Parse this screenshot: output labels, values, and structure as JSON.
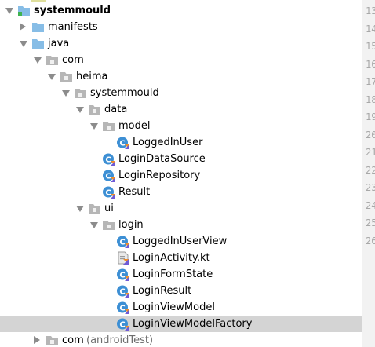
{
  "tree": {
    "items": [
      {
        "name": "folder-systemmould",
        "icon": "module-folder-icon",
        "label": "systemmould",
        "bold": true,
        "depth": 0,
        "arrow": "down"
      },
      {
        "name": "folder-manifests",
        "icon": "blue-folder-icon",
        "label": "manifests",
        "depth": 1,
        "arrow": "right"
      },
      {
        "name": "folder-java",
        "icon": "blue-folder-icon",
        "label": "java",
        "depth": 1,
        "arrow": "down"
      },
      {
        "name": "package-com",
        "icon": "package-icon",
        "label": "com",
        "depth": 2,
        "arrow": "down"
      },
      {
        "name": "package-heima",
        "icon": "package-icon",
        "label": "heima",
        "depth": 3,
        "arrow": "down"
      },
      {
        "name": "package-systemmould",
        "icon": "package-icon",
        "label": "systemmould",
        "depth": 4,
        "arrow": "down"
      },
      {
        "name": "package-data",
        "icon": "package-icon",
        "label": "data",
        "depth": 5,
        "arrow": "down"
      },
      {
        "name": "package-model",
        "icon": "package-icon",
        "label": "model",
        "depth": 6,
        "arrow": "down"
      },
      {
        "name": "class-loggedinuser",
        "icon": "kotlin-class-icon",
        "label": "LoggedInUser",
        "depth": 7
      },
      {
        "name": "class-logindatasource",
        "icon": "kotlin-class-icon",
        "label": "LoginDataSource",
        "depth": 6
      },
      {
        "name": "class-loginrepository",
        "icon": "kotlin-class-icon",
        "label": "LoginRepository",
        "depth": 6
      },
      {
        "name": "class-result",
        "icon": "kotlin-class-icon",
        "label": "Result",
        "depth": 6
      },
      {
        "name": "package-ui",
        "icon": "package-icon",
        "label": "ui",
        "depth": 5,
        "arrow": "down"
      },
      {
        "name": "package-login",
        "icon": "package-icon",
        "label": "login",
        "depth": 6,
        "arrow": "down"
      },
      {
        "name": "class-loggedinuserview",
        "icon": "kotlin-class-icon",
        "label": "LoggedInUserView",
        "depth": 7
      },
      {
        "name": "file-loginactivity",
        "icon": "kotlin-file-icon",
        "label": "LoginActivity.kt",
        "depth": 7
      },
      {
        "name": "class-loginformstate",
        "icon": "kotlin-class-icon",
        "label": "LoginFormState",
        "depth": 7
      },
      {
        "name": "class-loginresult",
        "icon": "kotlin-class-icon",
        "label": "LoginResult",
        "depth": 7
      },
      {
        "name": "class-loginviewmodel",
        "icon": "kotlin-class-icon",
        "label": "LoginViewModel",
        "depth": 7
      },
      {
        "name": "class-loginviewmodelfactory",
        "icon": "kotlin-class-icon",
        "label": "LoginViewModelFactory",
        "depth": 7,
        "selected": true
      },
      {
        "name": "package-com-androidtest",
        "icon": "package-icon",
        "label": "com",
        "suffix": "(androidTest)",
        "depth": 2,
        "arrow": "right"
      }
    ]
  },
  "gutter": {
    "line_numbers": [
      "13",
      "14",
      "15",
      "16",
      "17",
      "18",
      "19",
      "20",
      "21",
      "22",
      "23",
      "24",
      "25",
      "26"
    ]
  },
  "colors": {
    "folder_blue": "#87bde6",
    "package_gray": "#b6b6b6",
    "class_blue": "#3d8fd4",
    "kotlin_orange": "#f08d2a",
    "module_green": "#3fb34f",
    "selection": "#d4d4d4"
  }
}
